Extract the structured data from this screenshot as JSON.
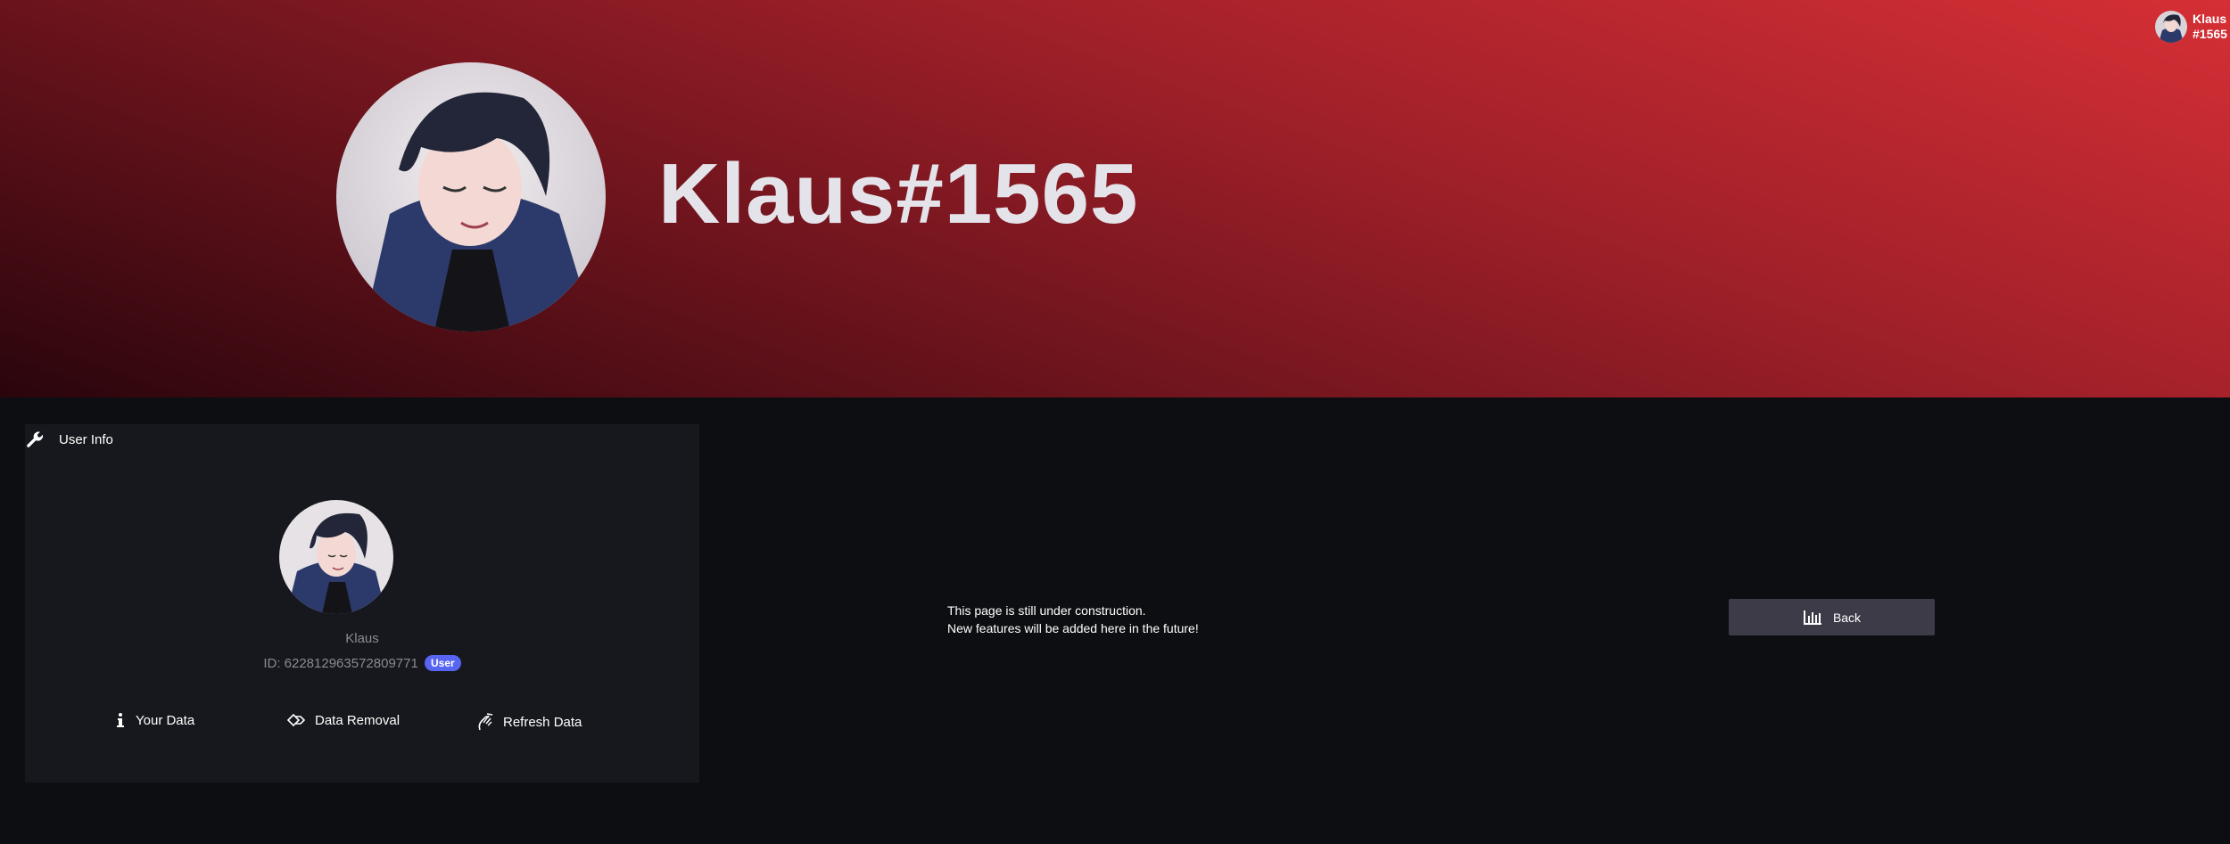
{
  "header": {
    "display_name": "Klaus#1565",
    "corner_user_line1": "Klaus",
    "corner_user_line2": "#1565"
  },
  "panel": {
    "title": "User Info",
    "title_icon": "wrench-icon",
    "username": "Klaus",
    "id_label": "ID: 622812963572809771",
    "role": "User",
    "actions": [
      {
        "label": "Your Data",
        "icon": "info-icon"
      },
      {
        "label": "Data Removal",
        "icon": "data-removal-icon"
      },
      {
        "label": "Refresh Data",
        "icon": "refresh-icon"
      }
    ]
  },
  "main": {
    "notice_line1": "This page is still under construction.",
    "notice_line2": "New features will be added here in the future!",
    "back_label": "Back",
    "back_icon": "chart-icon"
  },
  "colors": {
    "banner_start": "#2a050c",
    "banner_end": "#d52f35",
    "background": "#0d0e12",
    "panel": "#17181d",
    "role_badge": "#5865f2",
    "back_button": "#3d3b47"
  }
}
